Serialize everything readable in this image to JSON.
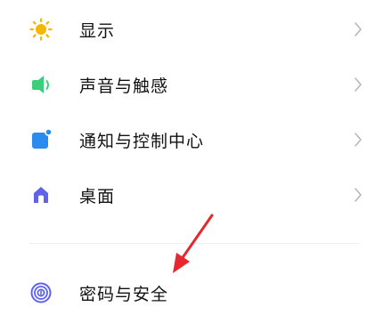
{
  "settings": {
    "items": [
      {
        "label": "显示",
        "icon": "sun-icon",
        "color": "#f5b800",
        "chevron": "chevron-right-icon"
      },
      {
        "label": "声音与触感",
        "icon": "speaker-icon",
        "color": "#3bcf7a",
        "chevron": "chevron-right-icon"
      },
      {
        "label": "通知与控制中心",
        "icon": "notification-icon",
        "color": "#2a8cf0",
        "chevron": "chevron-right-icon"
      },
      {
        "label": "桌面",
        "icon": "home-icon",
        "color": "#5f63e8",
        "chevron": "chevron-right-icon"
      },
      {
        "label": "密码与安全",
        "icon": "fingerprint-icon",
        "color": "#5f63e8"
      }
    ]
  },
  "annotation": {
    "arrow_color": "#e8262d"
  }
}
